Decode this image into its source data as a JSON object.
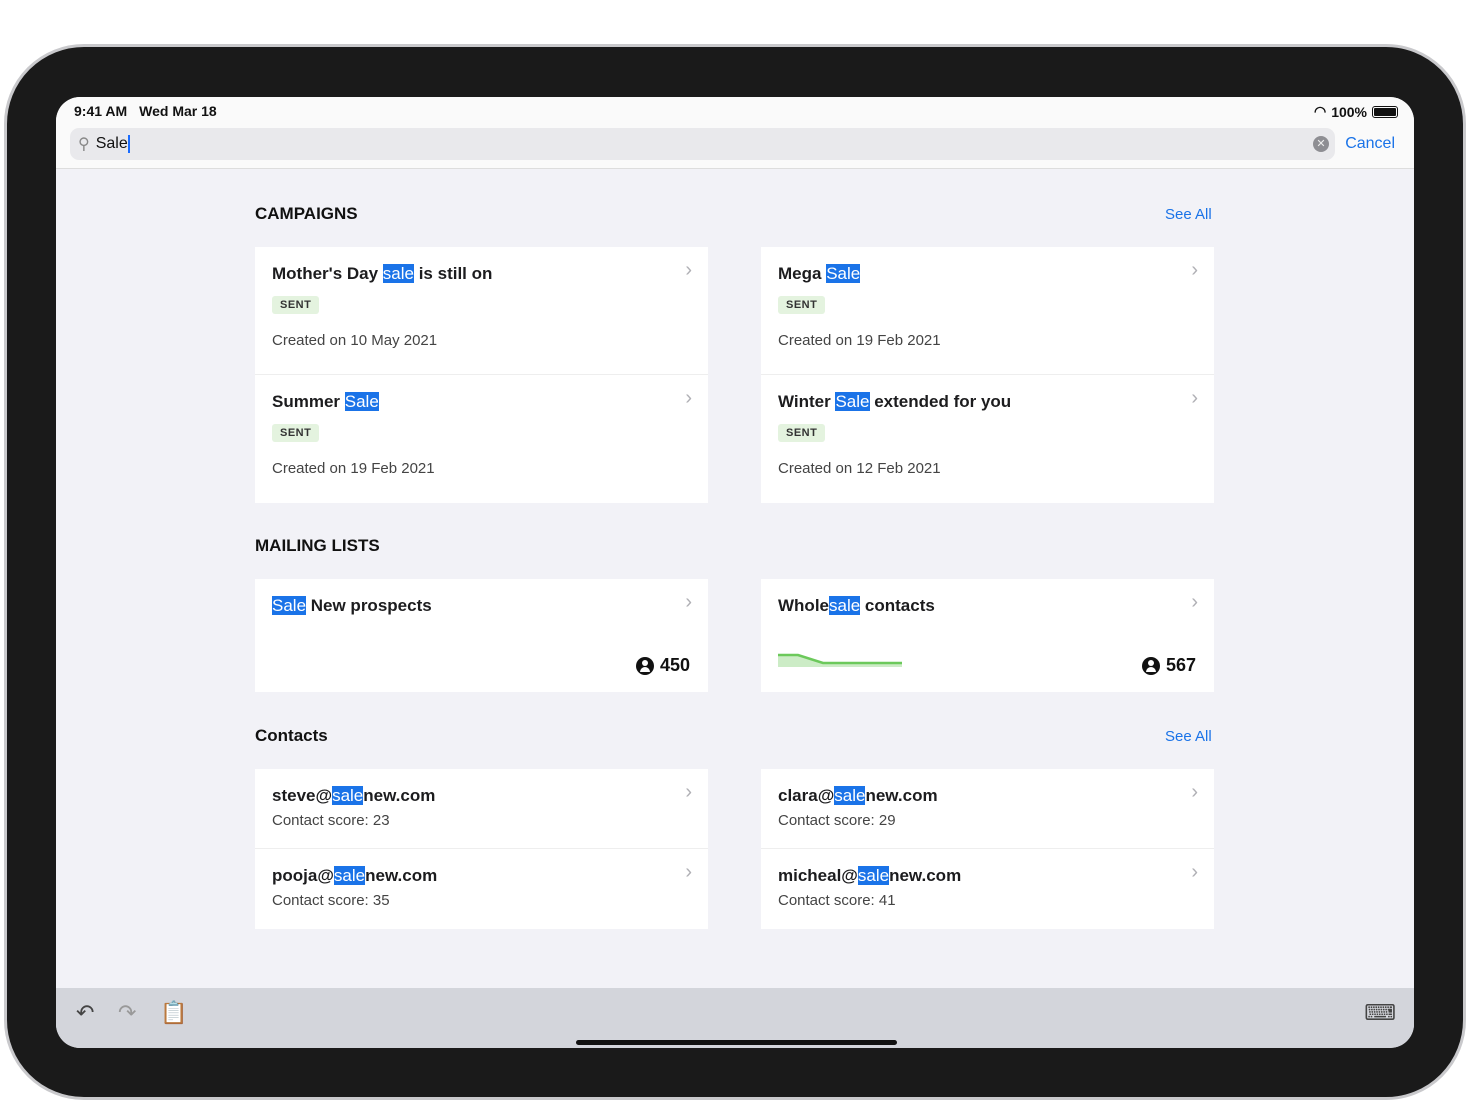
{
  "status": {
    "time": "9:41 AM",
    "date": "Wed Mar 18",
    "battery": "100%"
  },
  "search": {
    "value": "Sale",
    "cancel": "Cancel"
  },
  "campaigns": {
    "title": "CAMPAIGNS",
    "see_all": "See All",
    "items": [
      {
        "title": [
          {
            "t": "Mother's Day "
          },
          {
            "t": "sale",
            "hl": true
          },
          {
            "t": " is still on"
          }
        ],
        "badge": "SENT",
        "created": "Created on 10 May 2021"
      },
      {
        "title": [
          {
            "t": "Summer "
          },
          {
            "t": "Sale",
            "hl": true
          }
        ],
        "badge": "SENT",
        "created": "Created on 19 Feb 2021"
      },
      {
        "title": [
          {
            "t": "Mega "
          },
          {
            "t": "Sale",
            "hl": true
          }
        ],
        "badge": "SENT",
        "created": "Created on 19 Feb 2021"
      },
      {
        "title": [
          {
            "t": "Winter "
          },
          {
            "t": "Sale",
            "hl": true
          },
          {
            "t": " extended for you"
          }
        ],
        "badge": "SENT",
        "created": "Created on 12 Feb 2021"
      }
    ]
  },
  "mailing": {
    "title": "MAILING LISTS",
    "items": [
      {
        "title": [
          {
            "t": "Sale",
            "hl": true
          },
          {
            "t": " New prospects"
          }
        ],
        "count": "450",
        "sparkline": false
      },
      {
        "title": [
          {
            "t": "Whole"
          },
          {
            "t": "sale",
            "hl": true
          },
          {
            "t": " contacts"
          }
        ],
        "count": "567",
        "sparkline": true,
        "spark_color": "#6cc95b"
      }
    ]
  },
  "contacts": {
    "title": "Contacts",
    "see_all": "See All",
    "items": [
      {
        "title": [
          {
            "t": "steve@"
          },
          {
            "t": "sale",
            "hl": true
          },
          {
            "t": "new.com"
          }
        ],
        "score": "Contact score: 23"
      },
      {
        "title": [
          {
            "t": "pooja@"
          },
          {
            "t": "sale",
            "hl": true
          },
          {
            "t": "new.com"
          }
        ],
        "score": "Contact score: 35"
      },
      {
        "title": [
          {
            "t": "clara@"
          },
          {
            "t": "sale",
            "hl": true
          },
          {
            "t": "new.com"
          }
        ],
        "score": "Contact score: 29"
      },
      {
        "title": [
          {
            "t": "micheal@"
          },
          {
            "t": "sale",
            "hl": true
          },
          {
            "t": "new.com"
          }
        ],
        "score": "Contact score: 41"
      }
    ]
  },
  "colors": {
    "accent": "#1a73e8",
    "highlight": "#1a73e8",
    "badge_bg": "#e4f3df"
  }
}
